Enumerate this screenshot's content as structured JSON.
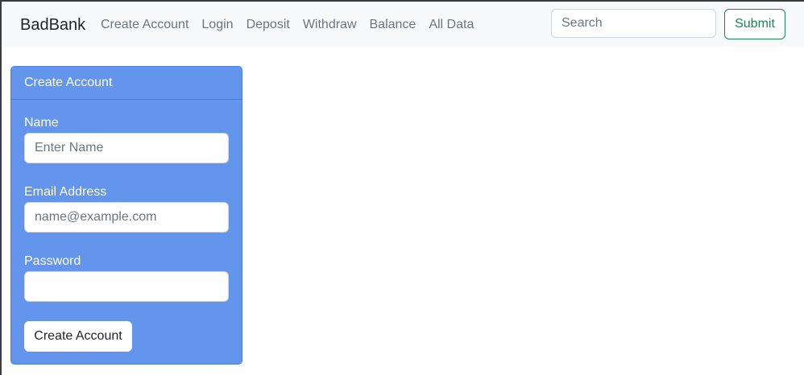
{
  "navbar": {
    "brand": "BadBank",
    "links": [
      "Create Account",
      "Login",
      "Deposit",
      "Withdraw",
      "Balance",
      "All Data"
    ],
    "search_placeholder": "Search",
    "submit_label": "Submit"
  },
  "card": {
    "header": "Create Account",
    "fields": [
      {
        "label": "Name",
        "placeholder": "Enter Name",
        "value": ""
      },
      {
        "label": "Email Address",
        "placeholder": "name@example.com",
        "value": ""
      },
      {
        "label": "Password",
        "placeholder": "",
        "value": ""
      }
    ],
    "button_label": "Create Account"
  },
  "colors": {
    "navbar_bg": "#f8f9fa",
    "card_bg": "#6495ed",
    "submit_outline": "#198754"
  }
}
